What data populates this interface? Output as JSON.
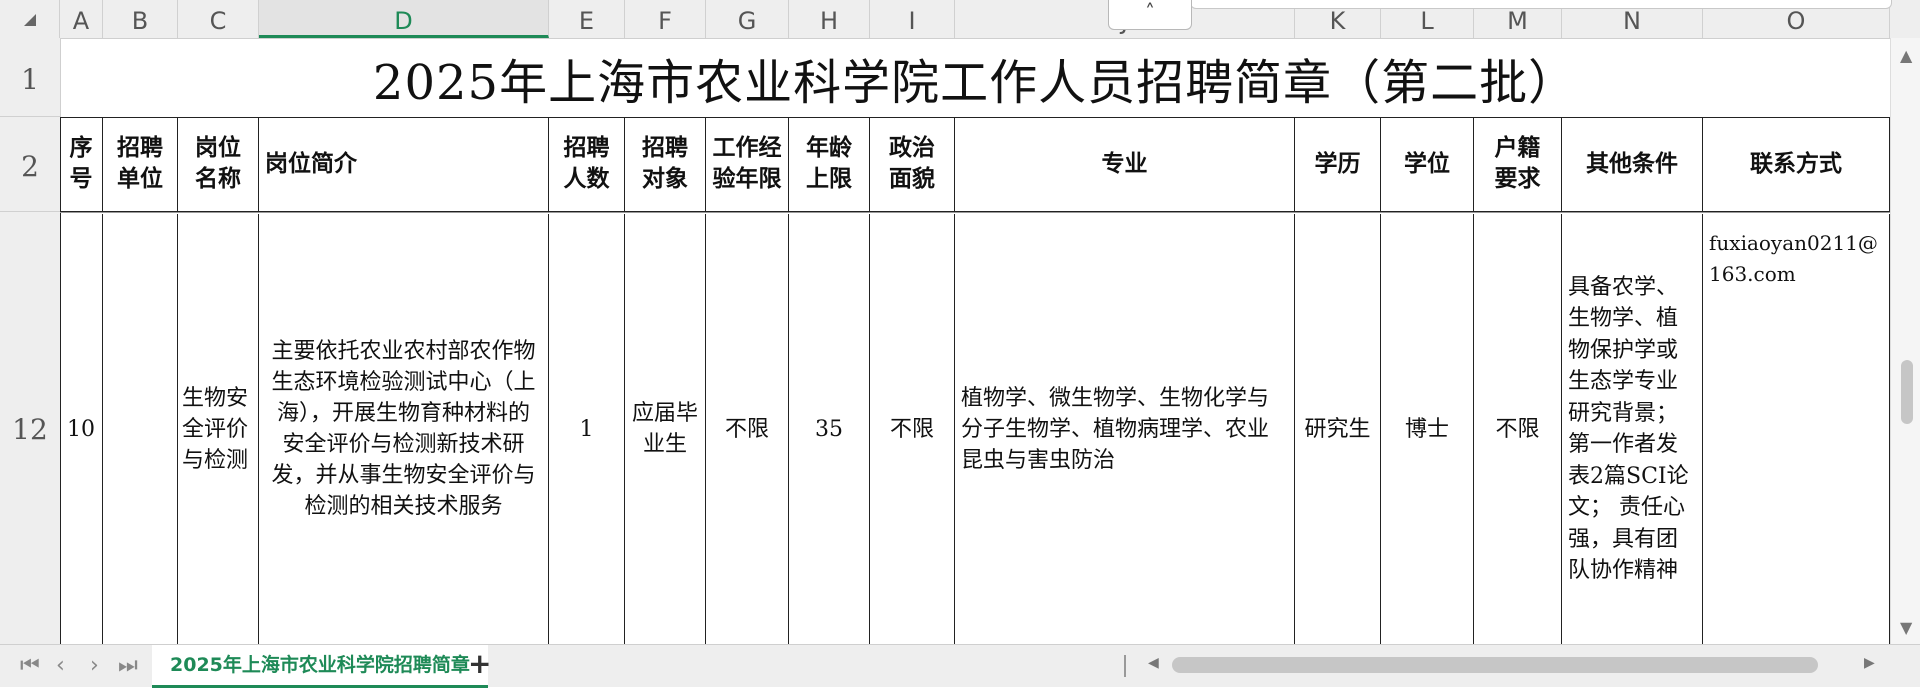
{
  "columns": [
    "A",
    "B",
    "C",
    "D",
    "E",
    "F",
    "G",
    "H",
    "I",
    "J",
    "K",
    "L",
    "M",
    "N",
    "O"
  ],
  "collapse_button": "˄",
  "rows": [
    "1",
    "2",
    "12"
  ],
  "title": "2025年上海市农业科学院工作人员招聘简章（第二批）",
  "headers": {
    "seq": "序号",
    "unit": "招聘单位",
    "post": "岗位名称",
    "intro": "岗位简介",
    "count": "招聘人数",
    "target": "招聘对象",
    "experience": "工作经验年限",
    "age": "年龄上限",
    "politics": "政治面貌",
    "major": "专业",
    "education": "学历",
    "degree": "学位",
    "hukou": "户籍要求",
    "other": "其他条件",
    "contact": "联系方式"
  },
  "row12": {
    "seq": "10",
    "unit": "",
    "post": "生物安全评价与检测",
    "intro": "主要依托农业农村部农作物生态环境检验测试中心（上海），开展生物育种材料的安全评价与检测新技术研发，并从事生物安全评价与检测的相关技术服务",
    "count": "1",
    "target": "应届毕业生",
    "experience": "不限",
    "age": "35",
    "politics": "不限",
    "major": "植物学、微生物学、生物化学与分子生物学、植物病理学、农业昆虫与害虫防治",
    "education": "研究生",
    "degree": "博士",
    "hukou": "不限",
    "other": "具备农学、生物学、植物保护学或生态学专业研究背景；第一作者发表2篇SCI论文；  责任心强，具有团队协作精神",
    "contact": "fuxiaoyan0211@163.com"
  },
  "sheet_tab": "2025年上海市农业科学院招聘简章",
  "add_sheet": "+",
  "nav": [
    "⏮",
    "‹",
    "›",
    "⏭"
  ],
  "colors": {
    "accent": "#1e8a57",
    "header_bg": "#eeeeee",
    "grid_line": "#222222"
  }
}
